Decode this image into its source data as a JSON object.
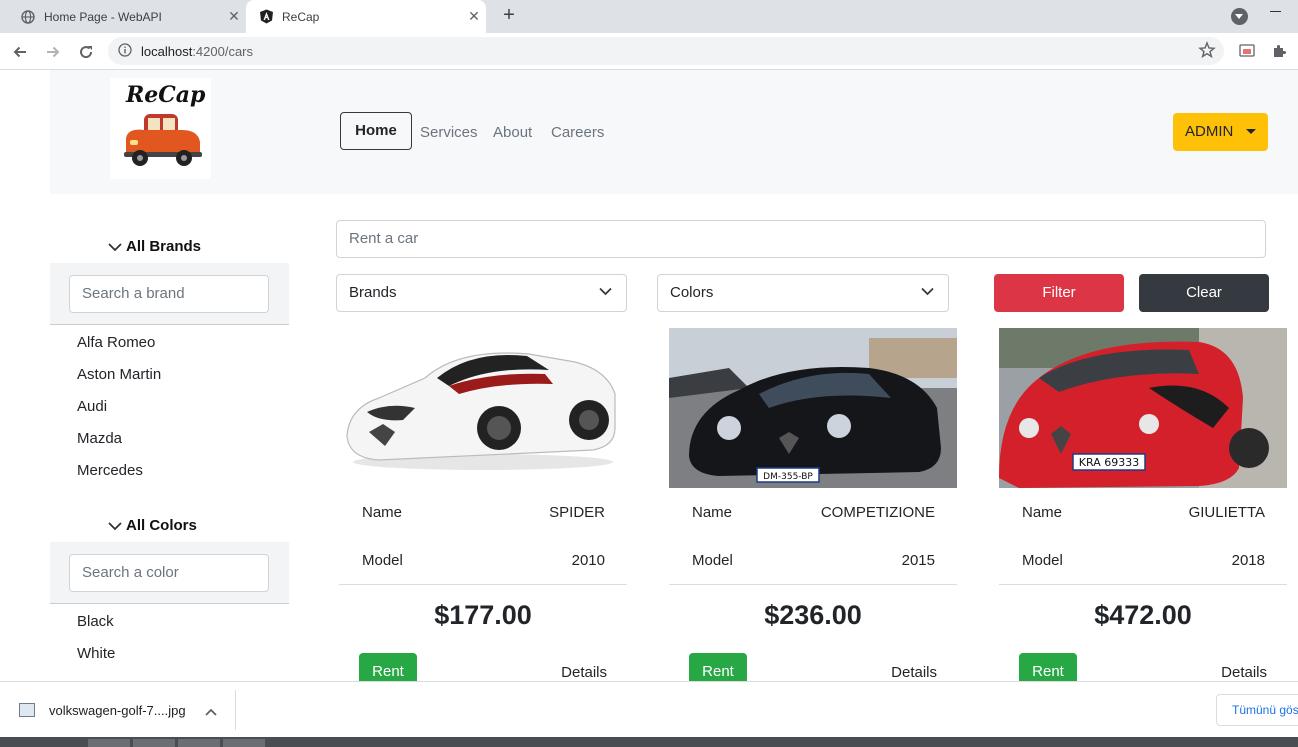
{
  "browser": {
    "tabs": [
      {
        "title": "Home Page - WebAPI",
        "active": false
      },
      {
        "title": "ReCap",
        "active": true
      }
    ],
    "url_host": "localhost",
    "url_path": ":4200/cars"
  },
  "navbar": {
    "logo_text": "ReCap",
    "links": {
      "home": "Home",
      "services": "Services",
      "about": "About",
      "careers": "Careers"
    },
    "admin_label": "ADMIN"
  },
  "sidebar": {
    "brands_heading": "All Brands",
    "brand_search_placeholder": "Search a brand",
    "brands": [
      "Alfa Romeo",
      "Aston Martin",
      "Audi",
      "Mazda",
      "Mercedes"
    ],
    "colors_heading": "All Colors",
    "color_search_placeholder": "Search a color",
    "colors": [
      "Black",
      "White"
    ]
  },
  "filters": {
    "rent_placeholder": "Rent a car",
    "brands_select": "Brands",
    "colors_select": "Colors",
    "filter_label": "Filter",
    "clear_label": "Clear"
  },
  "cars": [
    {
      "name_label": "Name",
      "name": "SPIDER",
      "model_label": "Model",
      "model": "2010",
      "price": "$177.00",
      "rent_label": "Rent",
      "details_label": "Details",
      "plate": ""
    },
    {
      "name_label": "Name",
      "name": "COMPETIZIONE",
      "model_label": "Model",
      "model": "2015",
      "price": "$236.00",
      "rent_label": "Rent",
      "details_label": "Details",
      "plate": "DM-355-BP"
    },
    {
      "name_label": "Name",
      "name": "GIULIETTA",
      "model_label": "Model",
      "model": "2018",
      "price": "$472.00",
      "rent_label": "Rent",
      "details_label": "Details",
      "plate": "KRA 69333"
    }
  ],
  "downloads": {
    "file_name": "volkswagen-golf-7....jpg",
    "show_all": "Tümünü göster"
  },
  "colors": {
    "admin": "#ffc107",
    "filter": "#dc3545",
    "clear": "#343a40",
    "rent": "#28a745"
  }
}
